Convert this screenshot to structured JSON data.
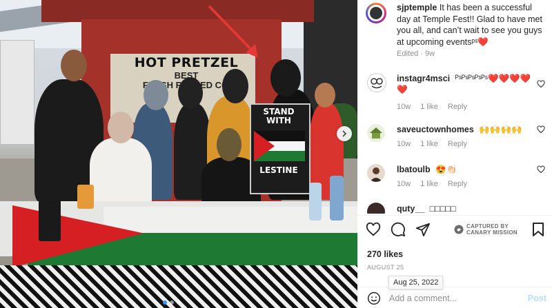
{
  "post": {
    "username": "sjptemple",
    "caption": "It has been a successful day at Temple Fest!! Glad to have met you all, and can’t wait to see you guys at upcoming eventsᵖˢ❤️",
    "edited_label": "Edited",
    "age": "9w",
    "likes": "270 likes",
    "date": "AUGUST 25",
    "date_tooltip": "Aug 25, 2022"
  },
  "photo": {
    "sign_main": "HOT PRETZEL",
    "sign_best": "BEST",
    "sign_fresh": "FRESH ROLLED COF",
    "poster_top": "STAND WITH",
    "poster_bottom": "LESTINE",
    "carousel_dots": 3,
    "carousel_active": 0
  },
  "comments": [
    {
      "user": "instagr4msci",
      "text": "ᴾˢᴾˢᴾˢᴾˢᴾˢ❤️❤️❤️❤️❤️",
      "age": "10w",
      "likes": "1 like",
      "reply": "Reply",
      "avatar": "owl-avatar"
    },
    {
      "user": "saveuctownhomes",
      "text": "🙌🙌🙌🙌",
      "age": "10w",
      "likes": "1 like",
      "reply": "Reply",
      "avatar": "house-avatar"
    },
    {
      "user": "lbatoulb",
      "text": "😍👏🏻",
      "age": "10w",
      "likes": "1 like",
      "reply": "Reply",
      "avatar": "person-avatar"
    },
    {
      "user": "quty__",
      "text": "□□□□□",
      "age": "",
      "likes": "",
      "reply": "",
      "avatar": "person-avatar-2"
    }
  ],
  "watermark": {
    "line1": "CAPTURED BY",
    "line2": "CANARY MISSION"
  },
  "composer": {
    "placeholder": "Add a comment...",
    "post_label": "Post"
  },
  "icons": {
    "like": "heart-icon",
    "comment": "comment-icon",
    "share": "share-icon",
    "save": "bookmark-icon",
    "emoji": "emoji-icon",
    "next": "chevron-right-icon"
  },
  "colors": {
    "accent": "#3897f0",
    "post_disabled": "#b2dffc",
    "heart": "#ed4956",
    "arrow": "#e53935"
  }
}
